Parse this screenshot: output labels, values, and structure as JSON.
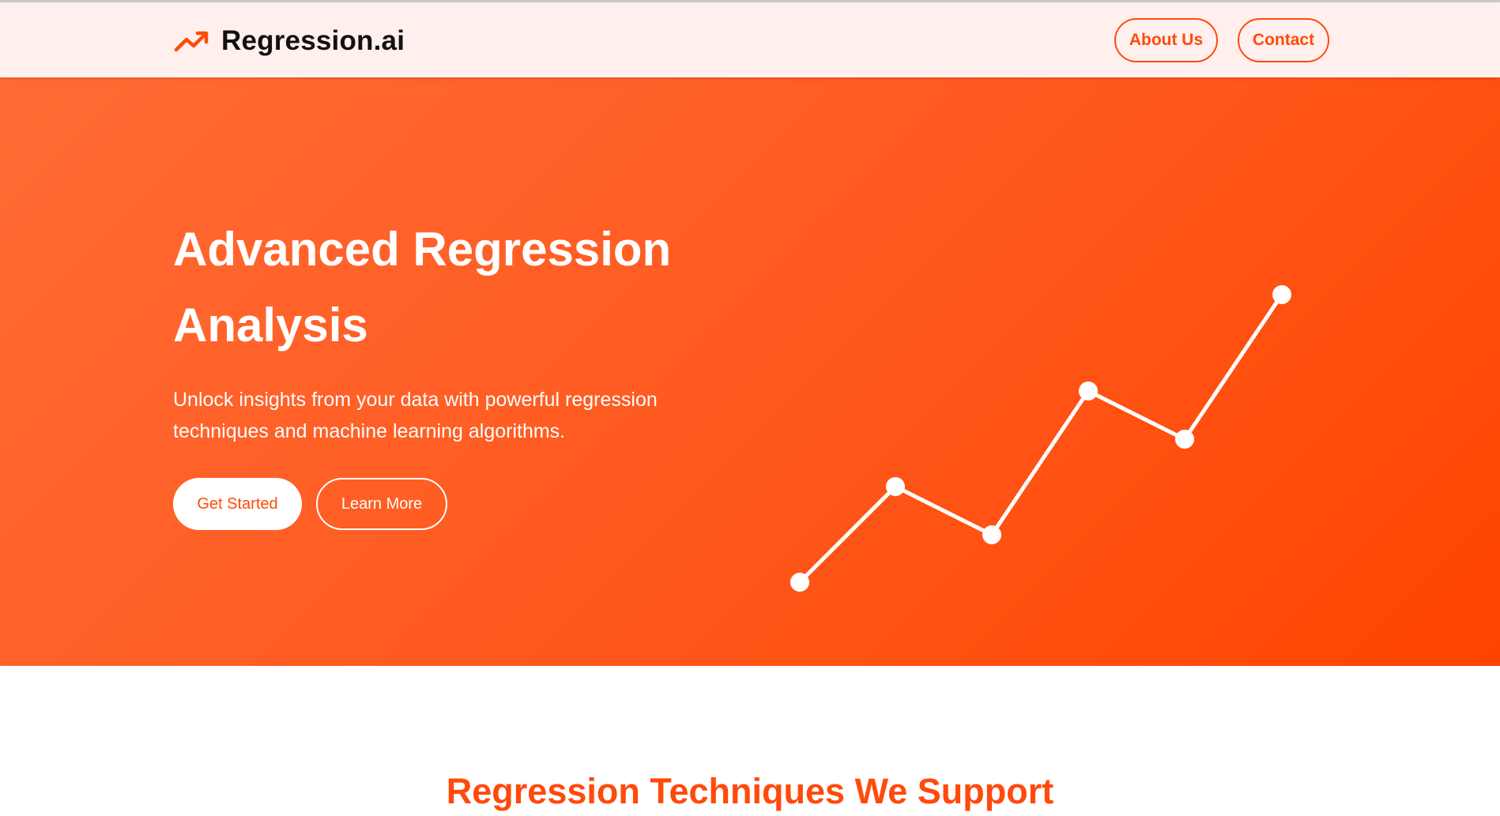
{
  "brand": {
    "name": "Regression.ai",
    "icon": "trending-up-icon",
    "accent_color": "#ff4a0b"
  },
  "nav": {
    "about_label": "About Us",
    "contact_label": "Contact"
  },
  "hero": {
    "title": "Advanced Regression Analysis",
    "subtitle": "Unlock insights from your data with powerful regression techniques and machine learning algorithms.",
    "primary_cta": "Get Started",
    "secondary_cta": "Learn More",
    "graph_icon": "line-graph-illustration",
    "gradient": [
      "#ff6b35",
      "#ff4400"
    ]
  },
  "techniques": {
    "heading": "Regression Techniques We Support"
  }
}
